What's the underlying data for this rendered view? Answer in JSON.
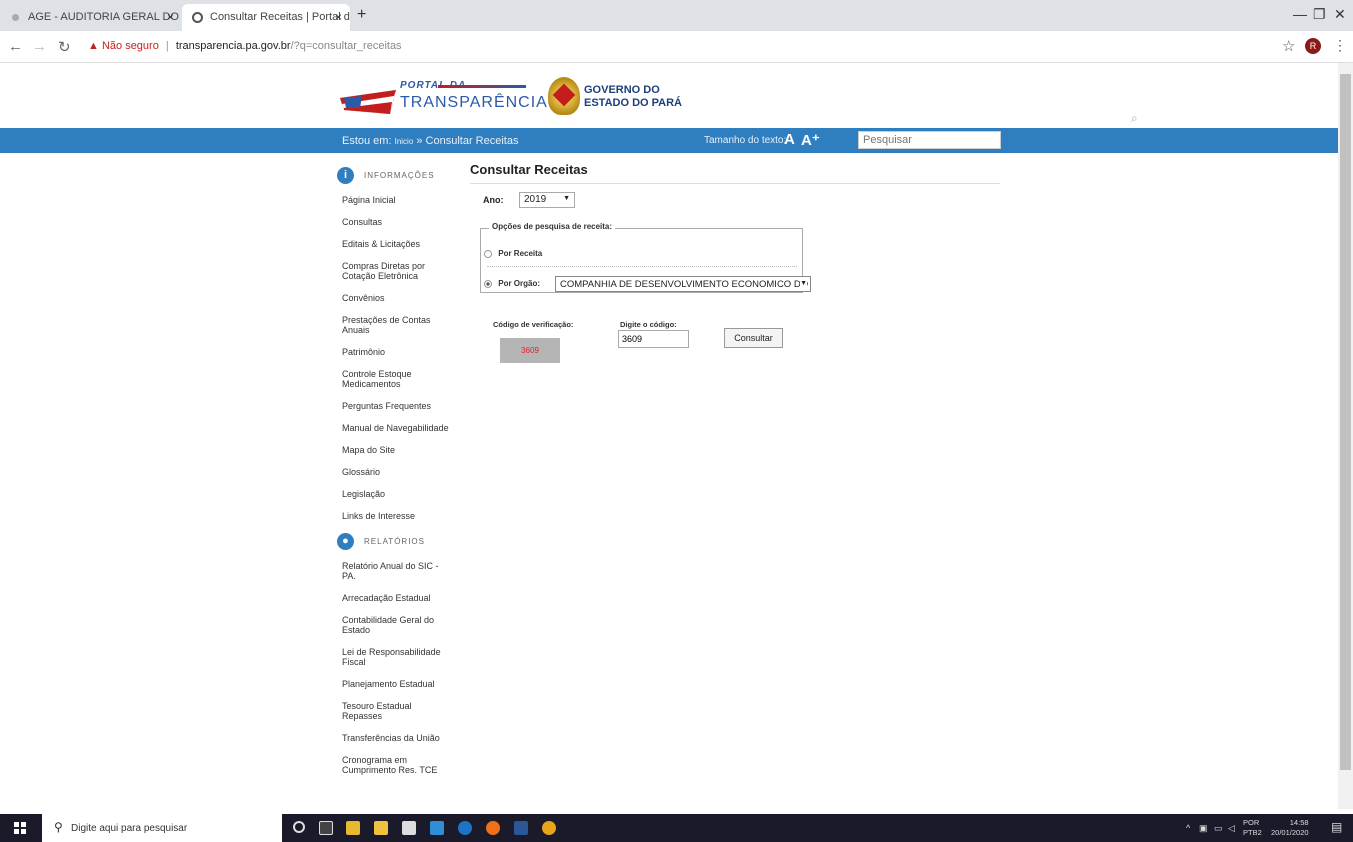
{
  "browser": {
    "tabs": [
      {
        "label": "AGE - AUDITORIA GERAL DO ES",
        "active": false
      },
      {
        "label": "Consultar Receitas | Portal da Tra",
        "active": true
      }
    ],
    "new_tab": "+",
    "address": {
      "warning": "▲",
      "not_secure": "Não seguro",
      "host": "transparencia.pa.gov.br",
      "path": "/?q=consultar_receitas"
    },
    "profile_initial": "R"
  },
  "header": {
    "portal_da": "PORTAL DA",
    "portal_name": "TRANSPARÊNCIA",
    "gov_line1": "GOVERNO DO",
    "gov_line2": "ESTADO DO PARÁ"
  },
  "navbar": {
    "estou_em": "Estou em:",
    "breadcrumb_home": "Inicio",
    "breadcrumb_sep": "»",
    "breadcrumb_current": "Consultar Receitas",
    "font_size_label": "Tamanho do texto:",
    "font_small": "A",
    "font_large": "A⁺",
    "search_placeholder": "Pesquisar"
  },
  "sidebar": {
    "info_title": "INFORMAÇÕES",
    "info_items": [
      "Página Inicial",
      "Consultas",
      "Editais & Licitações",
      "Compras Diretas por Cotação Eletrônica",
      "Convênios",
      "Prestações de Contas Anuais",
      "Patrimônio",
      "Controle Estoque Medicamentos",
      "Perguntas Frequentes",
      "Manual de Navegabilidade",
      "Mapa do Site",
      "Glossário",
      "Legislação",
      "Links de Interesse"
    ],
    "reports_title": "RELATÓRIOS",
    "report_items": [
      "Relatório Anual do SIC - PA.",
      "Arrecadação Estadual",
      "Contabilidade Geral do Estado",
      "Lei de Responsabilidade Fiscal",
      "Planejamento Estadual",
      "Tesouro Estadual Repasses",
      "Transferências da União",
      "Cronograma em Cumprimento Res. TCE"
    ]
  },
  "main": {
    "title": "Consultar Receitas",
    "ano_label": "Ano:",
    "ano_value": "2019",
    "options_legend": "Opções de pesquisa de receita:",
    "option_receita": "Por Receita",
    "option_orgao": "Por Orgão:",
    "orgao_value": "COMPANHIA DE DESENVOLVIMENTO ECONOMICO DO",
    "captcha_label": "Código de verificação:",
    "captcha_text": "3609",
    "code_label": "Digite o código:",
    "code_value": "3609",
    "submit_label": "Consultar"
  },
  "taskbar": {
    "search_placeholder": "Digite aqui para pesquisar",
    "lang": "POR",
    "lang2": "PTB2",
    "time": "14:58",
    "date": "20/01/2020"
  },
  "colors": {
    "navbar_bg": "#2f7fc0",
    "portal_blue": "#2b5aa8",
    "taskbar_bg": "#1a1a2a"
  }
}
